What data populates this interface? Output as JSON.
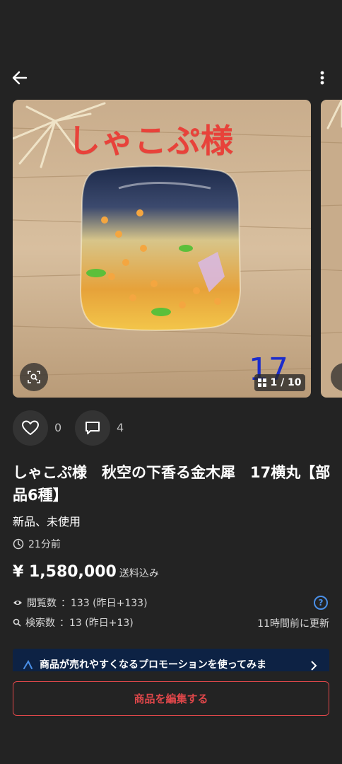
{
  "colors": {
    "background": "#232323",
    "accent_red": "#e0474a",
    "link_blue": "#4a8fe7",
    "promo_bg": "#0d2244"
  },
  "header": {
    "back_icon": "arrow-left-icon",
    "menu_icon": "more-vertical-icon"
  },
  "gallery": {
    "overlay_title": "しゃこぷ様",
    "overlay_number": "17",
    "counter": "1 / 10",
    "lens_icon": "visual-search-icon",
    "counter_icon": "grid-icon"
  },
  "actions": {
    "like_icon": "heart-icon",
    "like_count": "0",
    "comment_icon": "comment-icon",
    "comment_count": "4"
  },
  "product": {
    "title": "しゃこぷ様　秋空の下香る金木犀　17横丸【部品6種】",
    "condition": "新品、未使用",
    "posted_ago": "21分前",
    "price": "¥ 1,580,000",
    "shipping": "送料込み"
  },
  "stats": {
    "views_label": "閲覧数",
    "views_value": "：133 (昨日+133)",
    "searches_label": "検索数",
    "searches_value": "：13 (昨日+13)",
    "help": "?",
    "updated": "11時間前に更新"
  },
  "promo": {
    "text": "商品が売れやすくなるプロモーションを使ってみま"
  },
  "edit_button": {
    "label": "商品を編集する"
  }
}
